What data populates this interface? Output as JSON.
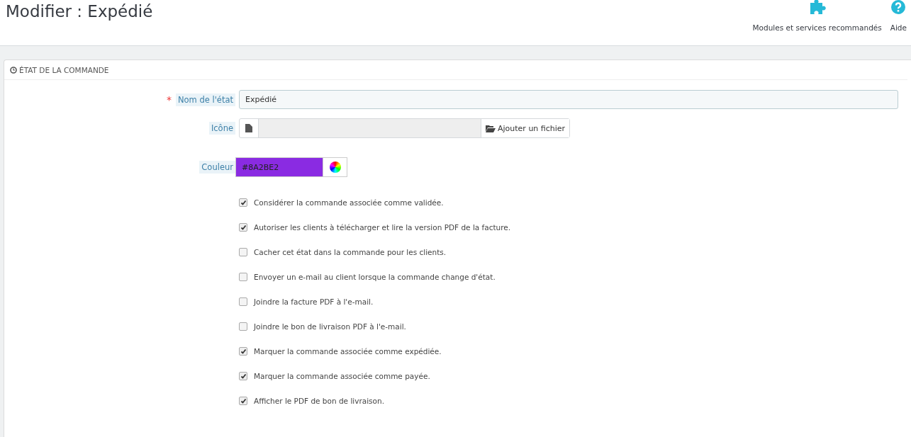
{
  "page_title": "Modifier : Expédié",
  "toolbar": [
    {
      "kind": "modules",
      "label": "Modules et services recommandés"
    },
    {
      "kind": "help",
      "label": "Aide"
    }
  ],
  "panel": {
    "title": "ÉTAT DE LA COMMANDE",
    "name_field": {
      "label": "Nom de l'état",
      "required_mark": "*",
      "value": "Expédié"
    },
    "icon_field": {
      "label": "Icône",
      "button": "Ajouter un fichier"
    },
    "color_field": {
      "label": "Couleur",
      "value": "#8A2BE2"
    },
    "options": [
      {
        "label": "Considérer la commande associée comme validée.",
        "checked": true
      },
      {
        "label": "Autoriser les clients à télécharger et lire la version PDF de la facture.",
        "checked": true
      },
      {
        "label": "Cacher cet état dans la commande pour les clients.",
        "checked": false
      },
      {
        "label": "Envoyer un e-mail au client lorsque la commande change d'état.",
        "checked": false
      },
      {
        "label": "Joindre la facture PDF à l'e-mail.",
        "checked": false
      },
      {
        "label": "Joindre le bon de livraison PDF à l'e-mail.",
        "checked": false
      },
      {
        "label": "Marquer la commande associée comme expédiée.",
        "checked": true
      },
      {
        "label": "Marquer la commande associée comme payée.",
        "checked": true
      },
      {
        "label": "Afficher le PDF de bon de livraison.",
        "checked": true
      }
    ]
  }
}
